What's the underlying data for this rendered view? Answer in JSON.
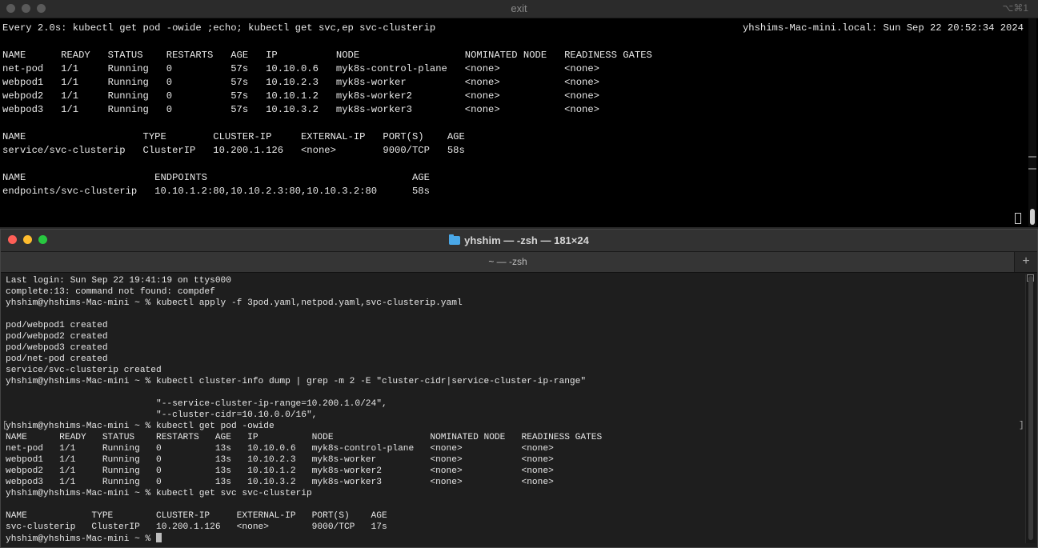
{
  "top_window": {
    "title": "exit",
    "shortcut": "⌥⌘1",
    "watch_command": "Every 2.0s: kubectl get pod -owide ;echo; kubectl get svc,ep svc-clusterip",
    "watch_host_time": "yhshims-Mac-mini.local: Sun Sep 22 20:52:34 2024",
    "lines": [
      "",
      "NAME      READY   STATUS    RESTARTS   AGE   IP          NODE                  NOMINATED NODE   READINESS GATES",
      "net-pod   1/1     Running   0          57s   10.10.0.6   myk8s-control-plane   <none>           <none>",
      "webpod1   1/1     Running   0          57s   10.10.2.3   myk8s-worker          <none>           <none>",
      "webpod2   1/1     Running   0          57s   10.10.1.2   myk8s-worker2         <none>           <none>",
      "webpod3   1/1     Running   0          57s   10.10.3.2   myk8s-worker3         <none>           <none>",
      "",
      "NAME                    TYPE        CLUSTER-IP     EXTERNAL-IP   PORT(S)    AGE",
      "service/svc-clusterip   ClusterIP   10.200.1.126   <none>        9000/TCP   58s",
      "",
      "NAME                      ENDPOINTS                                   AGE",
      "endpoints/svc-clusterip   10.10.1.2:80,10.10.2.3:80,10.10.3.2:80      58s"
    ]
  },
  "bottom_window": {
    "title": "yhshim — -zsh — 181×24",
    "tab_label": "~ — -zsh",
    "new_tab_label": "+",
    "lines": [
      "Last login: Sun Sep 22 19:41:19 on ttys000",
      "complete:13: command not found: compdef",
      "yhshim@yhshims-Mac-mini ~ % kubectl apply -f 3pod.yaml,netpod.yaml,svc-clusterip.yaml",
      "",
      "pod/webpod1 created",
      "pod/webpod2 created",
      "pod/webpod3 created",
      "pod/net-pod created",
      "service/svc-clusterip created",
      "yhshim@yhshims-Mac-mini ~ % kubectl cluster-info dump | grep -m 2 -E \"cluster-cidr|service-cluster-ip-range\"",
      "",
      "                            \"--service-cluster-ip-range=10.200.1.0/24\",",
      "                            \"--cluster-cidr=10.10.0.0/16\",",
      "yhshim@yhshims-Mac-mini ~ % kubectl get pod -owide",
      "NAME      READY   STATUS    RESTARTS   AGE   IP          NODE                  NOMINATED NODE   READINESS GATES",
      "net-pod   1/1     Running   0          13s   10.10.0.6   myk8s-control-plane   <none>           <none>",
      "webpod1   1/1     Running   0          13s   10.10.2.3   myk8s-worker          <none>           <none>",
      "webpod2   1/1     Running   0          13s   10.10.1.2   myk8s-worker2         <none>           <none>",
      "webpod3   1/1     Running   0          13s   10.10.3.2   myk8s-worker3         <none>           <none>",
      "yhshim@yhshims-Mac-mini ~ % kubectl get svc svc-clusterip",
      "",
      "NAME            TYPE        CLUSTER-IP     EXTERNAL-IP   PORT(S)    AGE",
      "svc-clusterip   ClusterIP   10.200.1.126   <none>        9000/TCP   17s"
    ],
    "prompt": "yhshim@yhshims-Mac-mini ~ % "
  }
}
